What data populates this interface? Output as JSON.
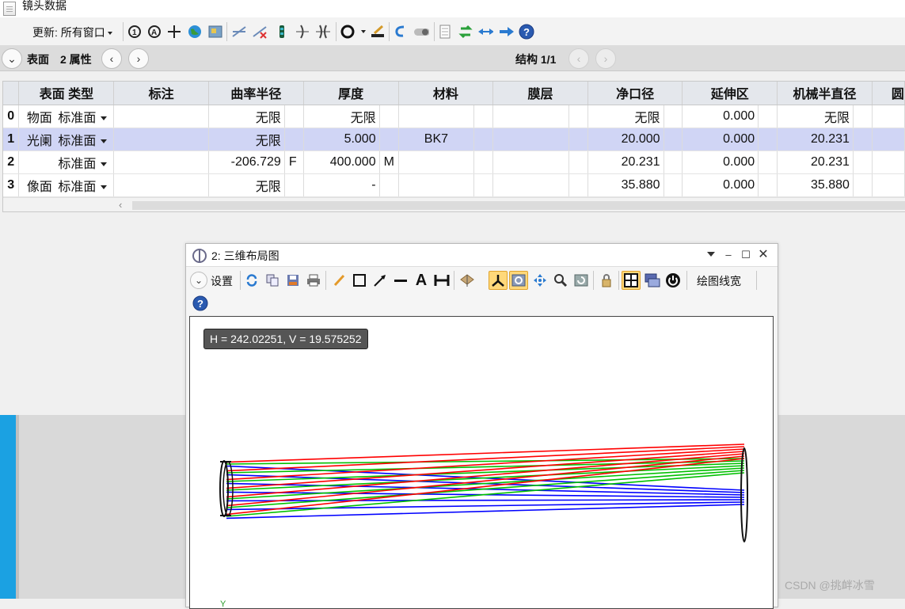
{
  "titlebar": {
    "title": "镜头数据"
  },
  "toolbar": {
    "update_label": "更新: 所有窗口",
    "icons": [
      "refresh-1-icon",
      "refresh-all-icon",
      "crosshair-icon",
      "globe-icon",
      "map-icon",
      "insert-surface-icon",
      "delete-surface-icon",
      "vertex-icon",
      "lens-icon",
      "element-icon",
      "circle-icon",
      "paint-icon",
      "undo-icon",
      "toggle-icon",
      "sheet-icon",
      "swap-icon",
      "arrows-icon",
      "arrow-right-icon",
      "help-icon"
    ]
  },
  "subbar": {
    "surface_label": "表面",
    "prop_label": "2 属性",
    "config_label": "结构 1/1"
  },
  "grid": {
    "headers": [
      "表面 类型",
      "标注",
      "曲率半径",
      "厚度",
      "材料",
      "膜层",
      "净口径",
      "延伸区",
      "机械半直径",
      "圆"
    ],
    "rows": [
      {
        "num": "0",
        "label": "物面",
        "type": "标准面",
        "comment": "",
        "radius": "无限",
        "radius_solve": "",
        "thickness": "无限",
        "thickness_solve": "",
        "material": "",
        "coating": "",
        "clear_semi": "无限",
        "chip": "0.000",
        "mech_semi": "无限"
      },
      {
        "num": "1",
        "label": "光阑",
        "type": "标准面",
        "comment": "",
        "radius": "无限",
        "radius_solve": "",
        "thickness": "5.000",
        "thickness_solve": "",
        "material": "BK7",
        "coating": "",
        "clear_semi": "20.000",
        "chip": "0.000",
        "mech_semi": "20.231"
      },
      {
        "num": "2",
        "label": "",
        "type": "标准面",
        "comment": "",
        "radius": "-206.729",
        "radius_solve": "F",
        "thickness": "400.000",
        "thickness_solve": "M",
        "material": "",
        "coating": "",
        "clear_semi": "20.231",
        "chip": "0.000",
        "mech_semi": "20.231"
      },
      {
        "num": "3",
        "label": "像面",
        "type": "标准面",
        "comment": "",
        "radius": "无限",
        "radius_solve": "",
        "thickness": "-",
        "thickness_solve": "",
        "material": "",
        "coating": "",
        "clear_semi": "35.880",
        "chip": "0.000",
        "mech_semi": "35.880"
      }
    ]
  },
  "window": {
    "title": "2: 三维布局图",
    "settings_label": "设置",
    "linewidth_label": "绘图线宽",
    "coord_readout": "H = 242.02251, V = 19.575252",
    "axis_label": "Y",
    "ray_colors": {
      "field1": "#0000ff",
      "field2": "#00c000",
      "field3": "#ff0000"
    }
  },
  "watermark": "CSDN @挑衅冰雪"
}
